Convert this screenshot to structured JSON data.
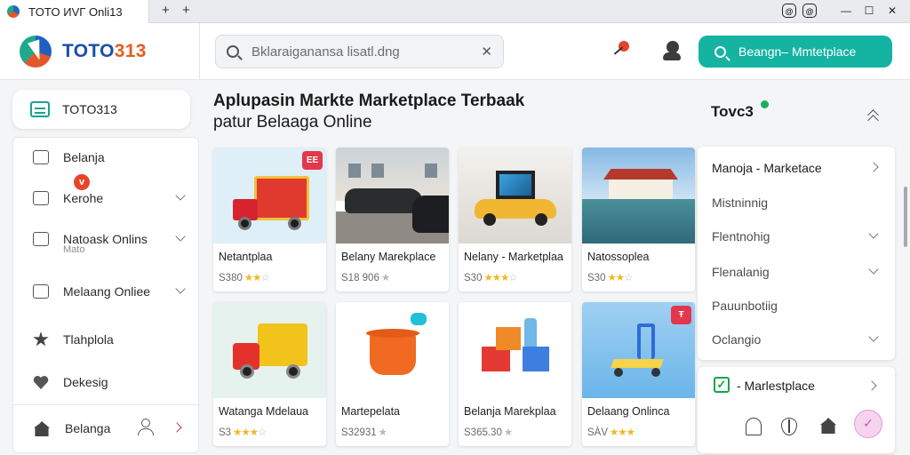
{
  "browser": {
    "tab_title": "TOTO ИVΓ Onli13",
    "new_tab": "+",
    "tab_close": "+",
    "controls": [
      "—",
      "☐",
      "✕"
    ]
  },
  "header": {
    "logo_part1": "TOTO",
    "logo_part2": "313",
    "search_placeholder": "Bklaraiganansa lisatl.dng",
    "search_clear": "✕",
    "cta_label": "Beangn– Mmtetplace"
  },
  "sidebar": {
    "top_item": "TOTO313",
    "items": [
      {
        "label": "Belanja"
      },
      {
        "label": "Kerohe"
      },
      {
        "label": "Natoask Onlins",
        "sub": "Mato"
      },
      {
        "label": "Melaang Onliee"
      },
      {
        "label": "Tlahplola"
      },
      {
        "label": "Dekesig"
      },
      {
        "label": "Belanga"
      }
    ],
    "badge": "v"
  },
  "main": {
    "title_line1": "Aplupasin Markte Marketplace Terbaak",
    "title_line2": "patur Belaaga Online",
    "products": [
      {
        "label": "Netantplaa",
        "price": "S380",
        "stars": "★★",
        "stars_off": "☆",
        "tag": "EE"
      },
      {
        "label": "Belany Marekplace",
        "price": "S18 906",
        "stars": "",
        "stars_off": "★"
      },
      {
        "label": "Nelany - Marketplaa",
        "price": "S30",
        "stars": "★★★",
        "stars_off": "☆"
      },
      {
        "label": "Natossoplea",
        "price": "S30",
        "stars": "★★",
        "stars_off": "☆"
      },
      {
        "label": "Watanga Mdelaua",
        "price": "S3",
        "stars": "★★★",
        "stars_off": "☆"
      },
      {
        "label": "Martepelata",
        "price": "S32931",
        "stars": "",
        "stars_off": "★"
      },
      {
        "label": "Belanja Marekplaa",
        "price": "S365.30",
        "stars": "",
        "stars_off": "★"
      },
      {
        "label": "Delaang Onlinca",
        "price": "SÀV",
        "stars": "★★★",
        "stars_off": "",
        "tag": "Ŧ"
      }
    ]
  },
  "right_panel": {
    "title": "Tovc3",
    "rows": [
      {
        "label": "Manoja - Marketace",
        "chevron": "right"
      },
      {
        "label": "Mistninnig",
        "chevron": "none"
      },
      {
        "label": "Flentnohig",
        "chevron": "down"
      },
      {
        "label": "Flenalanig",
        "chevron": "down"
      },
      {
        "label": "Pauunbotiig",
        "chevron": "none"
      },
      {
        "label": "Oclangio",
        "chevron": "down"
      }
    ],
    "bottom_label": "- Marlestplace",
    "fab_icon": "✓"
  },
  "colors": {
    "accent": "#14b3a2",
    "brand_blue": "#1b4fa8",
    "brand_orange": "#e35d22",
    "tag_red": "#e4374b",
    "star_gold": "#f2b91c"
  }
}
